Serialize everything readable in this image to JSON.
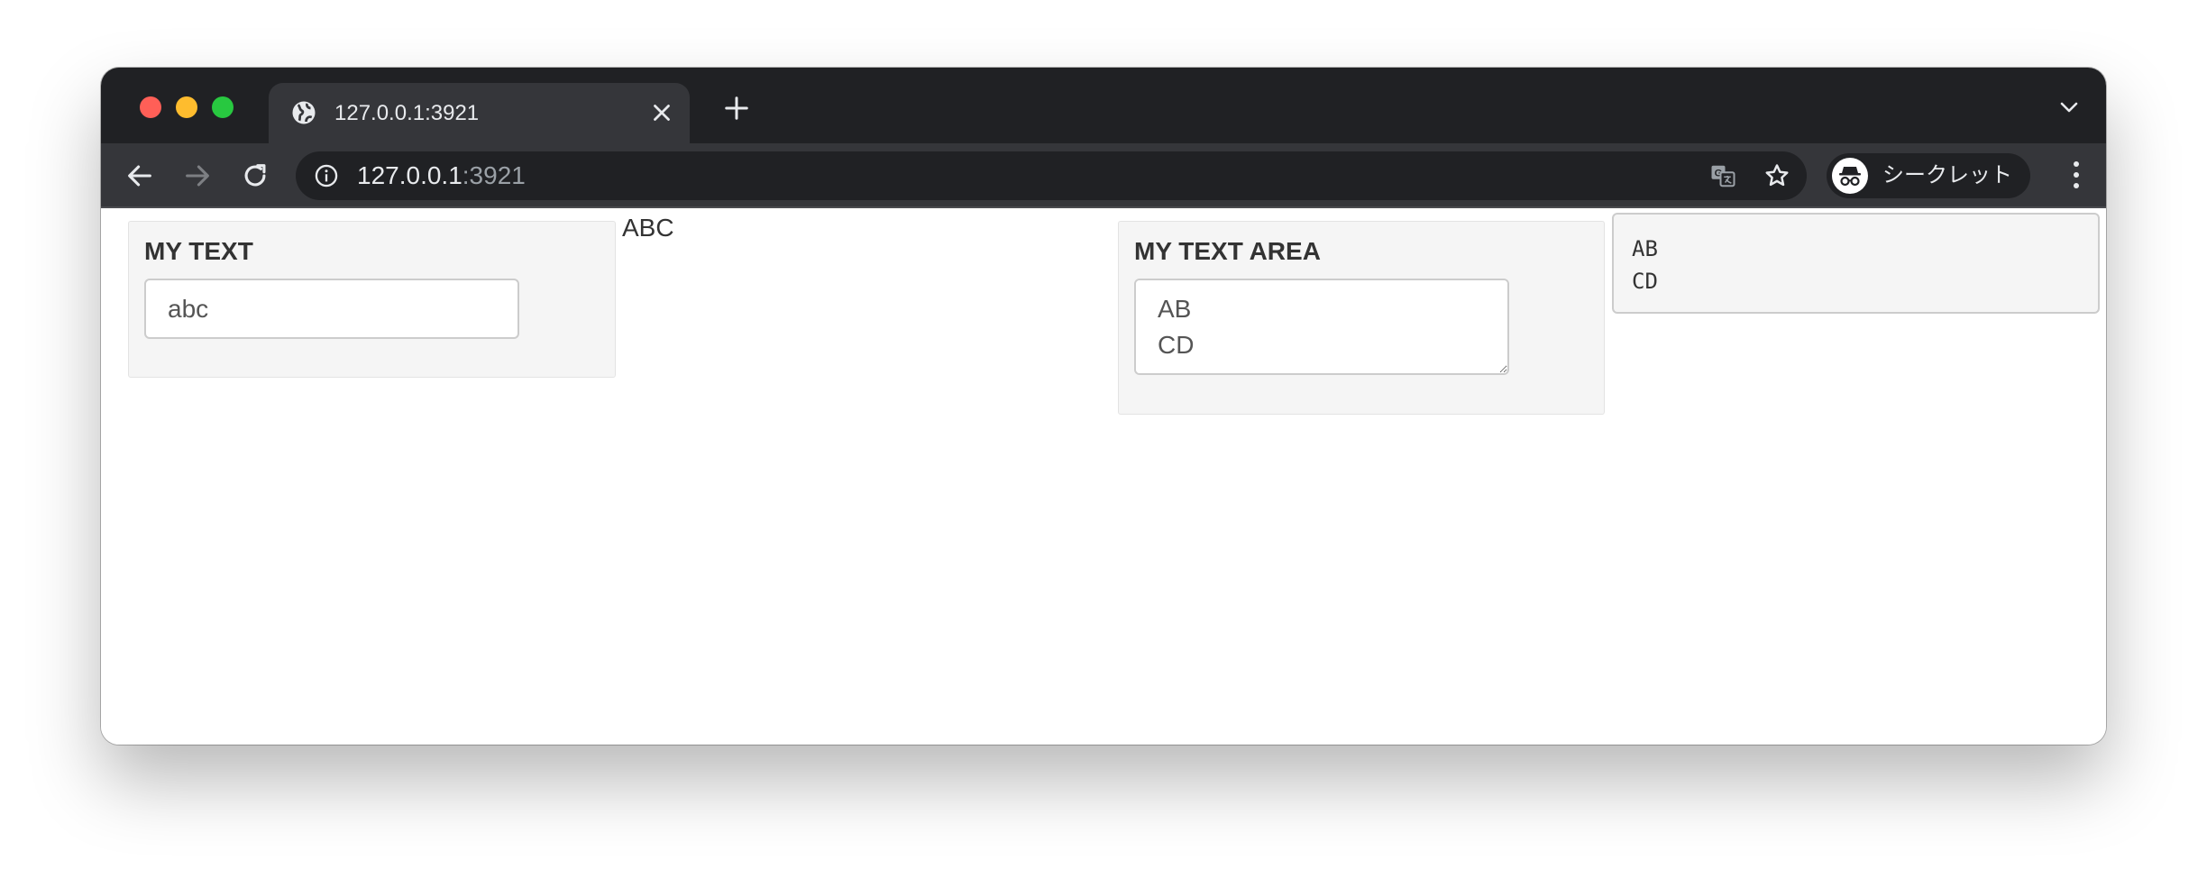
{
  "browser": {
    "tab": {
      "title": "127.0.0.1:3921",
      "icon": "globe-icon"
    },
    "address_bar": {
      "host": "127.0.0.1",
      "port": ":3921"
    },
    "profile": {
      "label": "シークレット",
      "icon": "incognito-icon"
    },
    "colors": {
      "tabstrip": "#202124",
      "toolbar": "#35363a",
      "text": "#e8eaed"
    }
  },
  "page": {
    "text_panel": {
      "label": "MY TEXT",
      "input_value": "abc"
    },
    "text_output": "ABC",
    "textarea_panel": {
      "label": "MY TEXT AREA",
      "textarea_value": "AB\nCD"
    },
    "verbatim_output": "AB\nCD"
  }
}
